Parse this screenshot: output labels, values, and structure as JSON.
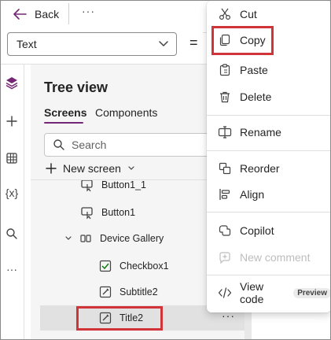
{
  "topbar": {
    "back_label": "Back",
    "more": "···"
  },
  "property_select": {
    "value": "Text",
    "equals": "="
  },
  "rail": {
    "variables_label": "{x}",
    "more": "···"
  },
  "tree": {
    "title": "Tree view",
    "tabs": [
      {
        "label": "Screens"
      },
      {
        "label": "Components"
      }
    ],
    "search_placeholder": "Search",
    "new_screen_label": "New screen",
    "items": [
      {
        "label": "Button1_1",
        "icon": "button-icon"
      },
      {
        "label": "Button1",
        "icon": "button-icon"
      },
      {
        "label": "Device Gallery",
        "icon": "gallery-icon"
      },
      {
        "label": "Checkbox1",
        "icon": "checkbox-icon"
      },
      {
        "label": "Subtitle2",
        "icon": "edit-icon"
      },
      {
        "label": "Title2",
        "icon": "edit-icon",
        "more": "···"
      }
    ]
  },
  "context_menu": {
    "items": [
      {
        "label": "Cut",
        "icon": "scissors-icon"
      },
      {
        "label": "Copy",
        "icon": "copy-icon"
      },
      {
        "label": "Paste",
        "icon": "paste-icon"
      },
      {
        "label": "Delete",
        "icon": "trash-icon"
      },
      {
        "label": "Rename",
        "icon": "rename-icon"
      },
      {
        "label": "Reorder",
        "icon": "reorder-icon"
      },
      {
        "label": "Align",
        "icon": "align-icon"
      },
      {
        "label": "Copilot",
        "icon": "copilot-icon"
      },
      {
        "label": "New comment",
        "icon": "comment-add-icon",
        "disabled": true
      },
      {
        "label": "View code",
        "icon": "code-icon",
        "badge": "Preview"
      }
    ]
  },
  "colors": {
    "accent": "#742774",
    "highlight": "#d13438",
    "selected_row": "#e1e1e1"
  }
}
